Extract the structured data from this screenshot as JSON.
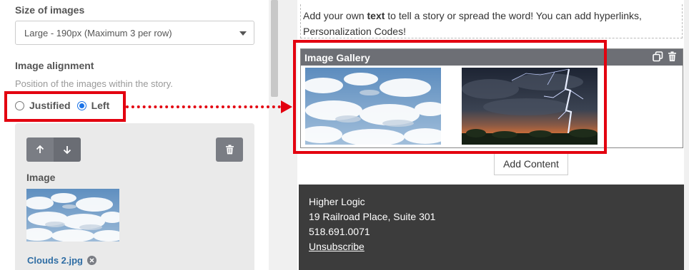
{
  "settings": {
    "size_label": "Size of images",
    "size_select_value": "Large - 190px (Maximum 3 per row)",
    "alignment_label": "Image alignment",
    "alignment_helper": "Position of the images within the story.",
    "alignment_options": [
      "Justified",
      "Left"
    ],
    "alignment_selected": "Left",
    "image_card": {
      "image_label": "Image",
      "file_name": "Clouds 2.jpg"
    }
  },
  "preview": {
    "text_block": {
      "before_bold": "Add your own ",
      "bold": "text",
      "after_bold": " to tell a story or spread the word! You can add hyperlinks,",
      "line2": "Personalization Codes!"
    },
    "gallery_title": "Image Gallery",
    "add_content_label": "Add Content",
    "footer": {
      "org_name": "Higher Logic",
      "address": "19 Railroad Place, Suite 301",
      "phone": "518.691.0071",
      "unsubscribe": "Unsubscribe"
    }
  },
  "colors": {
    "highlight": "#e3000f",
    "radio_accent": "#1a73e8",
    "file_link": "#2f6da4",
    "gallery_header": "#6d6f75",
    "footer_bg": "#3c3c3c"
  },
  "icons": [
    "arrow-up-icon",
    "arrow-down-icon",
    "trash-icon",
    "remove-circle-icon",
    "copy-icon",
    "chevron-down-icon"
  ]
}
